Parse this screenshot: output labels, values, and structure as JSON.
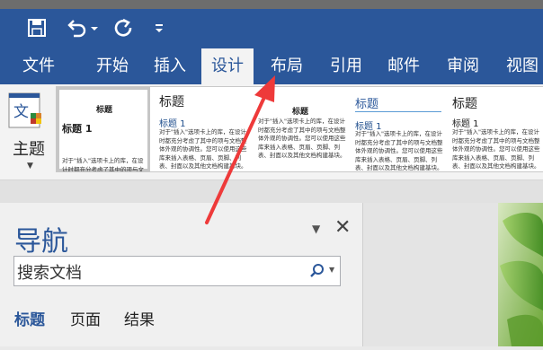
{
  "quick_access": {
    "icons": [
      "save-icon",
      "undo-icon",
      "dropdown-icon",
      "redo-icon",
      "customize-icon"
    ]
  },
  "ribbon_tabs": [
    "文件",
    "开始",
    "插入",
    "设计",
    "布局",
    "引用",
    "邮件",
    "审阅",
    "视图"
  ],
  "active_tab": "设计",
  "theme": {
    "label": "主题",
    "icon_text": "文"
  },
  "style_gallery": {
    "cards": [
      {
        "title": "标题",
        "heading": "标题 1",
        "text": "对于\"插入\"选项卡上的库，在设计时都充分考虑了其中的项与文档整体外观的协调性。"
      },
      {
        "title": "标题",
        "heading": "标题 1",
        "text": "对于\"插入\"选项卡上的库，在设计时都充分考虑了其中的项与文档整体外观的协调性。您可以使用这些库来插入表格、页眉、页脚、列表、封面以及其他文档构建基块。"
      },
      {
        "title": "标题",
        "heading": "",
        "text": "对于\"插入\"选项卡上的库，在设计时都充分考虑了其中的项与文档整体外观的协调性。您可以使用这些库来插入表格、页眉、页脚、列表、封面以及其他文档构建基块。"
      },
      {
        "title": "标题",
        "heading": "标题 1",
        "text": "对于\"插入\"选项卡上的库，在设计时都充分考虑了其中的项与文档整体外观的协调性。您可以使用这些库来插入表格、页眉、页脚、列表、封面以及其他文档构建基块。"
      },
      {
        "title": "标题",
        "heading": "标题 1",
        "text": "对于\"插入\"选项卡上的库，在设计时都充分考虑了其中的项与文档整体外观的协调性。您可以使用这些库来插入表格、页眉、页脚、列表、封面以及其他文档构建基块。"
      }
    ]
  },
  "navigation": {
    "title": "导航",
    "search_placeholder": "搜索文档",
    "tabs": [
      "标题",
      "页面",
      "结果"
    ],
    "active_tab": "标题"
  },
  "colors": {
    "ribbon_blue": "#2b579a",
    "arrow_red": "#ee3a3a"
  }
}
